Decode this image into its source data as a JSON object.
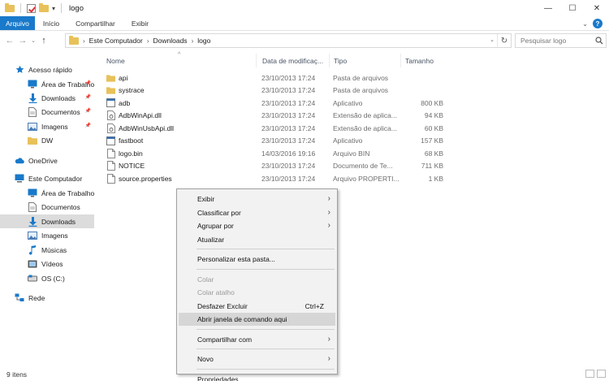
{
  "window": {
    "title": "logo",
    "controls": [
      "minimize",
      "maximize",
      "close"
    ]
  },
  "ribbon": {
    "tabs": [
      {
        "label": "Arquivo",
        "active": true
      },
      {
        "label": "Início"
      },
      {
        "label": "Compartilhar"
      },
      {
        "label": "Exibir"
      }
    ]
  },
  "address": {
    "crumbs": [
      "Este Computador",
      "Downloads",
      "logo"
    ],
    "search_placeholder": "Pesquisar logo"
  },
  "nav": {
    "items": [
      {
        "label": "Acesso rápido",
        "icon": "star-icon",
        "color": "#1979ca"
      },
      {
        "label": "Área de Trabalho",
        "icon": "desktop-icon",
        "pinned": true,
        "color": "#1979ca"
      },
      {
        "label": "Downloads",
        "icon": "download-icon",
        "pinned": true,
        "color": "#1979ca"
      },
      {
        "label": "Documentos",
        "icon": "document-icon",
        "pinned": true,
        "color": "#7a7a7a"
      },
      {
        "label": "Imagens",
        "icon": "image-icon",
        "pinned": true,
        "color": "#4a7bb5"
      },
      {
        "label": "DW",
        "icon": "folder-icon",
        "color": "#e8c15a"
      },
      {
        "label": "OneDrive",
        "icon": "cloud-icon",
        "color": "#1979ca"
      },
      {
        "label": "Este Computador",
        "icon": "computer-icon",
        "color": "#1979ca"
      },
      {
        "label": "Área de Trabalho",
        "icon": "desktop-icon",
        "color": "#1979ca"
      },
      {
        "label": "Documentos",
        "icon": "document-icon",
        "color": "#7a7a7a"
      },
      {
        "label": "Downloads",
        "icon": "download-icon",
        "selected": true,
        "color": "#1979ca"
      },
      {
        "label": "Imagens",
        "icon": "image-icon",
        "color": "#4a7bb5"
      },
      {
        "label": "Músicas",
        "icon": "music-icon",
        "color": "#1979ca"
      },
      {
        "label": "Vídeos",
        "icon": "video-icon",
        "color": "#555555"
      },
      {
        "label": "OS (C:)",
        "icon": "drive-icon",
        "color": "#6a6a6a"
      },
      {
        "label": "Rede",
        "icon": "network-icon",
        "color": "#1979ca"
      }
    ]
  },
  "columns": {
    "name": "Nome",
    "date": "Data de modificaç...",
    "type": "Tipo",
    "size": "Tamanho"
  },
  "files": [
    {
      "name": "api",
      "date": "23/10/2013 17:24",
      "type": "Pasta de arquivos",
      "size": "",
      "icon": "folder-icon"
    },
    {
      "name": "systrace",
      "date": "23/10/2013 17:24",
      "type": "Pasta de arquivos",
      "size": "",
      "icon": "folder-icon"
    },
    {
      "name": "adb",
      "date": "23/10/2013 17:24",
      "type": "Aplicativo",
      "size": "800 KB",
      "icon": "app-icon"
    },
    {
      "name": "AdbWinApi.dll",
      "date": "23/10/2013 17:24",
      "type": "Extensão de aplica...",
      "size": "94 KB",
      "icon": "dll-icon"
    },
    {
      "name": "AdbWinUsbApi.dll",
      "date": "23/10/2013 17:24",
      "type": "Extensão de aplica...",
      "size": "60 KB",
      "icon": "dll-icon"
    },
    {
      "name": "fastboot",
      "date": "23/10/2013 17:24",
      "type": "Aplicativo",
      "size": "157 KB",
      "icon": "app-icon"
    },
    {
      "name": "logo.bin",
      "date": "14/03/2016 19:16",
      "type": "Arquivo BIN",
      "size": "68 KB",
      "icon": "file-icon"
    },
    {
      "name": "NOTICE",
      "date": "23/10/2013 17:24",
      "type": "Documento de Te...",
      "size": "711 KB",
      "icon": "file-icon"
    },
    {
      "name": "source.properties",
      "date": "23/10/2013 17:24",
      "type": "Arquivo PROPERTI...",
      "size": "1 KB",
      "icon": "file-icon"
    }
  ],
  "context_menu": {
    "items": [
      {
        "label": "Exibir",
        "submenu": true
      },
      {
        "label": "Classificar por",
        "submenu": true
      },
      {
        "label": "Agrupar por",
        "submenu": true
      },
      {
        "label": "Atualizar"
      },
      {
        "separator": true
      },
      {
        "label": "Personalizar esta pasta..."
      },
      {
        "separator": true
      },
      {
        "label": "Colar",
        "disabled": true
      },
      {
        "label": "Colar atalho",
        "disabled": true
      },
      {
        "label": "Desfazer Excluir",
        "shortcut": "Ctrl+Z"
      },
      {
        "label": "Abrir janela de comando aqui",
        "highlight": true
      },
      {
        "separator": true
      },
      {
        "label": "Compartilhar com",
        "submenu": true
      },
      {
        "separator": true
      },
      {
        "label": "Novo",
        "submenu": true
      },
      {
        "separator": true
      },
      {
        "label": "Propriedades"
      }
    ]
  },
  "status": {
    "item_count": "9 itens"
  }
}
